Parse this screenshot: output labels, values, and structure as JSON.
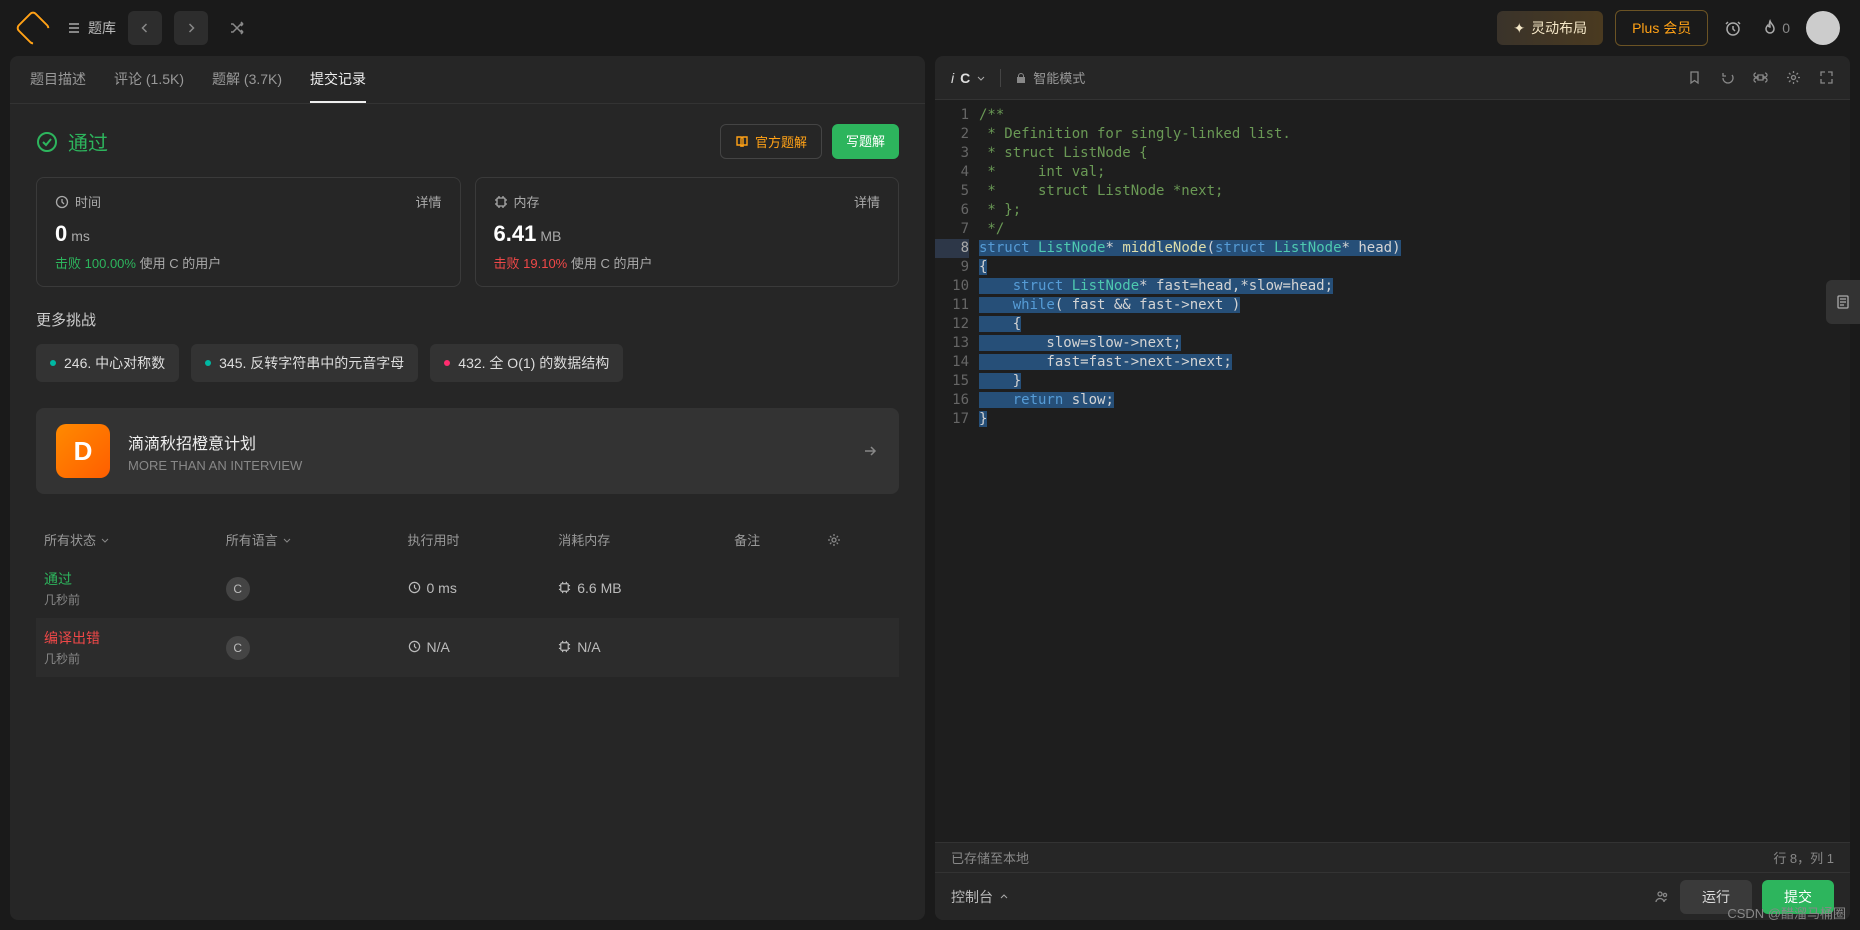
{
  "topbar": {
    "problems_label": "题库",
    "dynamic_layout": "灵动布局",
    "plus_label": "Plus 会员",
    "streak_count": "0"
  },
  "left": {
    "tabs": {
      "desc": "题目描述",
      "discuss": "评论 (1.5K)",
      "solutions": "题解 (3.7K)",
      "submissions": "提交记录"
    },
    "status_label": "通过",
    "official_solution": "官方题解",
    "write_solution": "写题解",
    "time_card": {
      "title": "时间",
      "detail": "详情",
      "value": "0",
      "unit": "ms",
      "beat_label": "击败",
      "beat_pct": "100.00%",
      "beat_suffix": "使用 C 的用户"
    },
    "mem_card": {
      "title": "内存",
      "detail": "详情",
      "value": "6.41",
      "unit": "MB",
      "beat_label": "击败",
      "beat_pct": "19.10%",
      "beat_suffix": "使用 C 的用户"
    },
    "more_challenges": "更多挑战",
    "chips": [
      "246. 中心对称数",
      "345. 反转字符串中的元音字母",
      "432. 全 O(1) 的数据结构"
    ],
    "promo": {
      "title": "滴滴秋招橙意计划",
      "subtitle": "MORE THAN AN INTERVIEW"
    },
    "table": {
      "col_status": "所有状态",
      "col_lang": "所有语言",
      "col_runtime": "执行用时",
      "col_memory": "消耗内存",
      "col_note": "备注",
      "rows": [
        {
          "status": "通过",
          "time": "几秒前",
          "lang": "C",
          "runtime": "0 ms",
          "memory": "6.6 MB"
        },
        {
          "status": "编译出错",
          "time": "几秒前",
          "lang": "C",
          "runtime": "N/A",
          "memory": "N/A"
        }
      ]
    }
  },
  "editor": {
    "language": "C",
    "mode": "智能模式",
    "saved": "已存储至本地",
    "cursor": "行 8，列 1",
    "console": "控制台",
    "run": "运行",
    "submit": "提交",
    "code_lines": [
      {
        "n": 1,
        "raw": "/**",
        "cls": [
          "comment"
        ]
      },
      {
        "n": 2,
        "raw": " * Definition for singly-linked list.",
        "cls": [
          "comment"
        ]
      },
      {
        "n": 3,
        "raw": " * struct ListNode {",
        "cls": [
          "comment"
        ]
      },
      {
        "n": 4,
        "raw": " *     int val;",
        "cls": [
          "comment"
        ]
      },
      {
        "n": 5,
        "raw": " *     struct ListNode *next;",
        "cls": [
          "comment"
        ]
      },
      {
        "n": 6,
        "raw": " * };",
        "cls": [
          "comment"
        ]
      },
      {
        "n": 7,
        "raw": " */",
        "cls": [
          "comment"
        ]
      },
      {
        "n": 8,
        "raw": "struct ListNode* middleNode(struct ListNode* head)",
        "sel": true
      },
      {
        "n": 9,
        "raw": "{",
        "sel": true
      },
      {
        "n": 10,
        "raw": "    struct ListNode* fast=head,*slow=head;",
        "sel": true
      },
      {
        "n": 11,
        "raw": "    while( fast && fast->next )",
        "sel": true
      },
      {
        "n": 12,
        "raw": "    {",
        "sel": true
      },
      {
        "n": 13,
        "raw": "        slow=slow->next;",
        "sel": true
      },
      {
        "n": 14,
        "raw": "        fast=fast->next->next;",
        "sel": true
      },
      {
        "n": 15,
        "raw": "    }",
        "sel": true
      },
      {
        "n": 16,
        "raw": "    return slow;",
        "sel": true
      },
      {
        "n": 17,
        "raw": "}",
        "sel": true
      }
    ]
  },
  "watermark": "CSDN @醋溜马桶圈"
}
